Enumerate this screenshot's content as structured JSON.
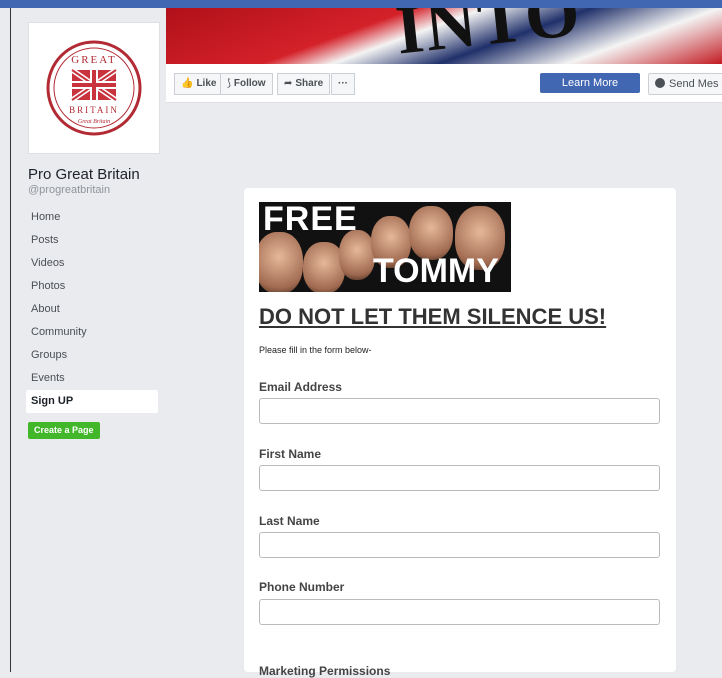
{
  "page": {
    "name": "Pro Great Britain",
    "handle": "@progreatbritain",
    "logo_text_top": "GREAT",
    "logo_text_bottom": "BRITAIN",
    "logo_script": "Great Britain"
  },
  "sidebar": {
    "items": [
      {
        "label": "Home"
      },
      {
        "label": "Posts"
      },
      {
        "label": "Videos"
      },
      {
        "label": "Photos"
      },
      {
        "label": "About"
      },
      {
        "label": "Community"
      },
      {
        "label": "Groups"
      },
      {
        "label": "Events"
      },
      {
        "label": "Sign UP",
        "active": true
      }
    ],
    "create_page_label": "Create a Page"
  },
  "cover": {
    "text": "INTO"
  },
  "actions": {
    "like": "Like",
    "follow": "Follow",
    "share": "Share",
    "more": "···",
    "learn_more": "Learn More",
    "send_message": "Send Mes"
  },
  "form": {
    "banner_top": "FREE",
    "banner_bottom": "TOMMY",
    "headline": "DO NOT LET THEM SILENCE US!",
    "intro": "Please fill in the form below-",
    "fields": [
      {
        "label": "Email Address",
        "value": ""
      },
      {
        "label": "First Name",
        "value": ""
      },
      {
        "label": "Last Name",
        "value": ""
      },
      {
        "label": "Phone Number",
        "value": ""
      }
    ],
    "section_heading": "Marketing Permissions"
  },
  "colors": {
    "facebook_blue": "#4267b2",
    "create_green": "#42b72a"
  }
}
